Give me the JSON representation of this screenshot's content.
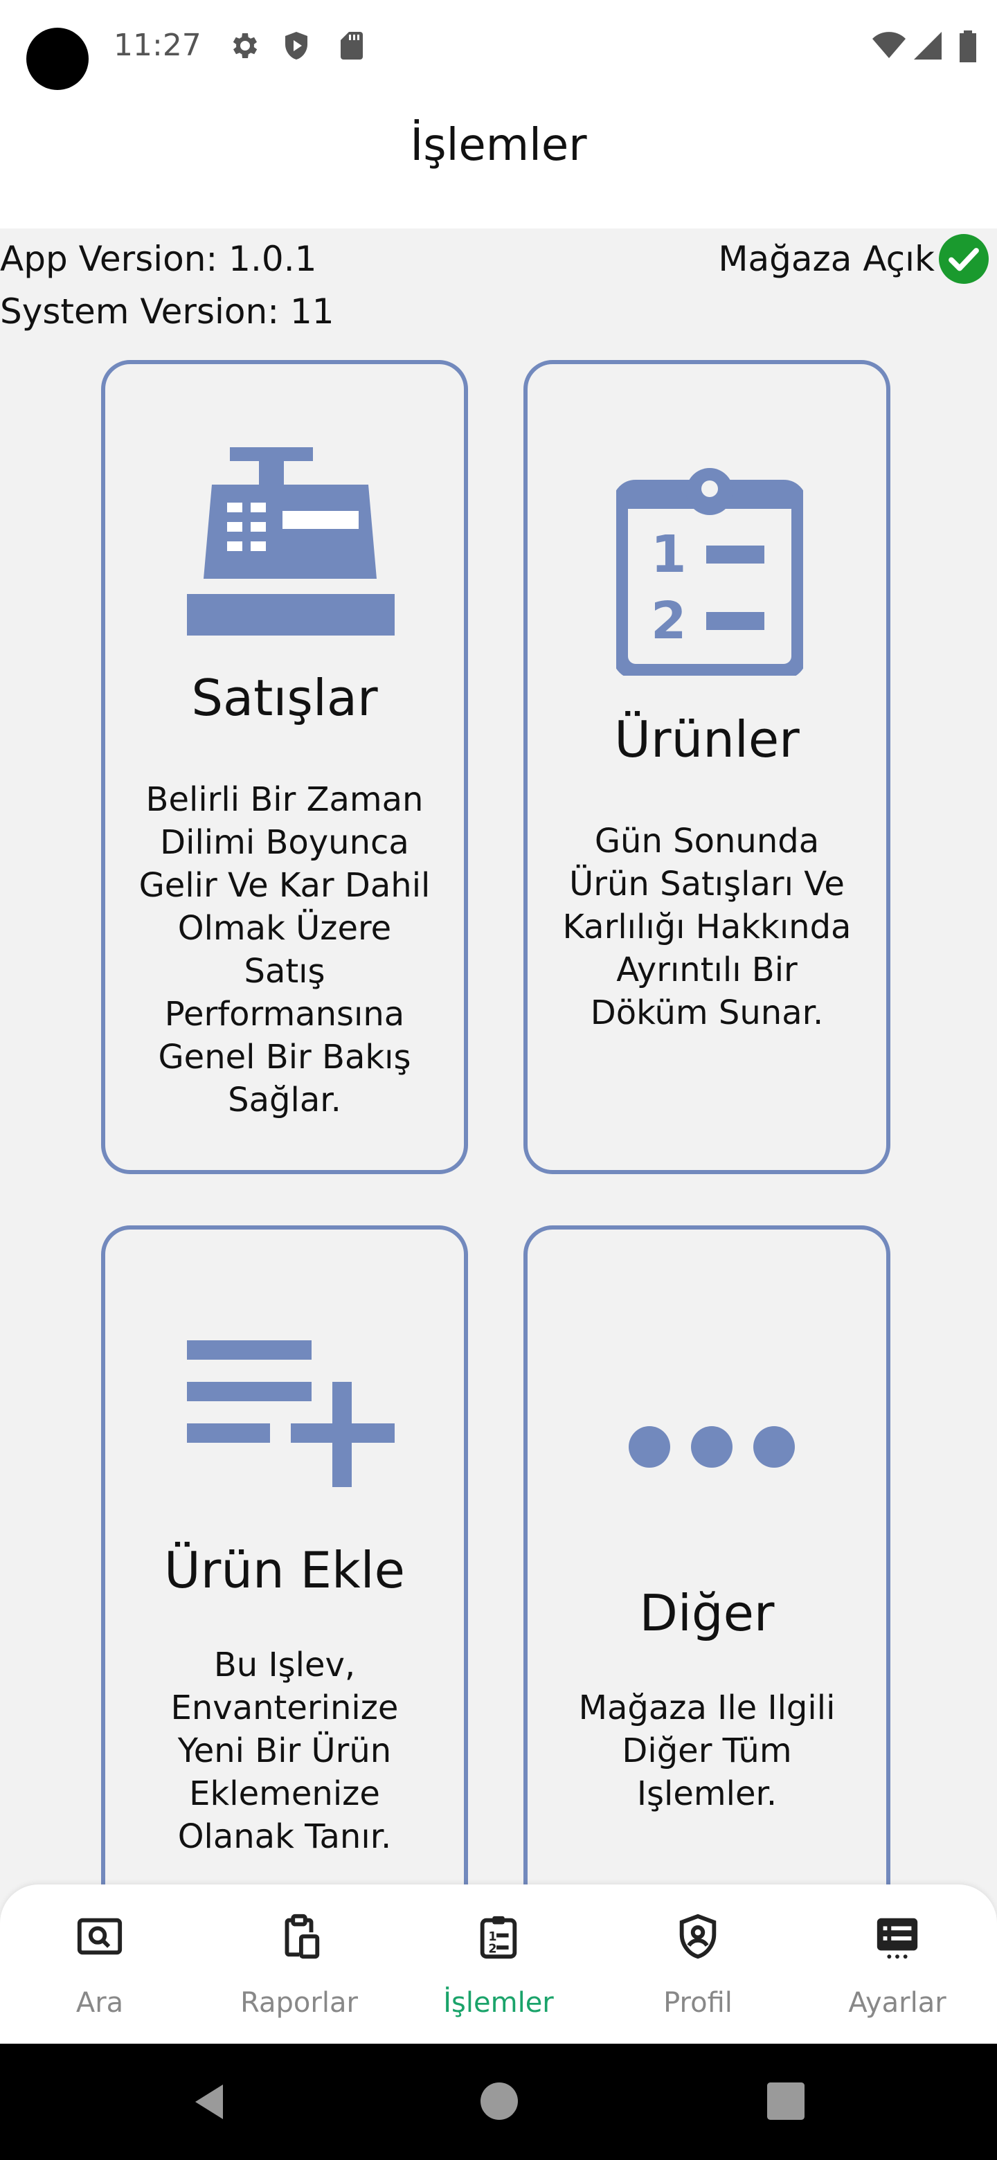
{
  "status_bar": {
    "time": "11:27"
  },
  "header": {
    "title": "İşlemler"
  },
  "info": {
    "app_version": "App Version: 1.0.1",
    "system_version": "System Version: 11",
    "store_status": "Mağaza Açık"
  },
  "cards": [
    {
      "title": "Satışlar",
      "description": "Belirli Bir Zaman Dilimi Boyunca Gelir Ve Kar Dahil Olmak Üzere Satış Performansına Genel Bir Bakış Sağlar.",
      "icon": "cash-register-icon"
    },
    {
      "title": "Ürünler",
      "description": "Gün Sonunda Ürün Satışları Ve Karlılığı Hakkında Ayrıntılı Bir Döküm Sunar.",
      "icon": "clipboard-list-icon"
    },
    {
      "title": "Ürün Ekle",
      "description": "Bu Işlev, Envanterinize Yeni Bir Ürün Eklemenize Olanak Tanır.",
      "icon": "playlist-add-icon"
    },
    {
      "title": "Diğer",
      "description": "Mağaza Ile Ilgili Diğer Tüm Işlemler.",
      "icon": "more-horizontal-icon"
    }
  ],
  "bottom_nav": [
    {
      "label": "Ara",
      "icon": "search-icon"
    },
    {
      "label": "Raporlar",
      "icon": "reports-icon"
    },
    {
      "label": "İşlemler",
      "icon": "operations-icon",
      "active": true
    },
    {
      "label": "Profil",
      "icon": "profile-shield-icon"
    },
    {
      "label": "Ayarlar",
      "icon": "settings-list-icon"
    }
  ],
  "colors": {
    "accent": "#7289bd",
    "active_nav": "#1aa36a",
    "status_ok": "#1a9a2e"
  }
}
